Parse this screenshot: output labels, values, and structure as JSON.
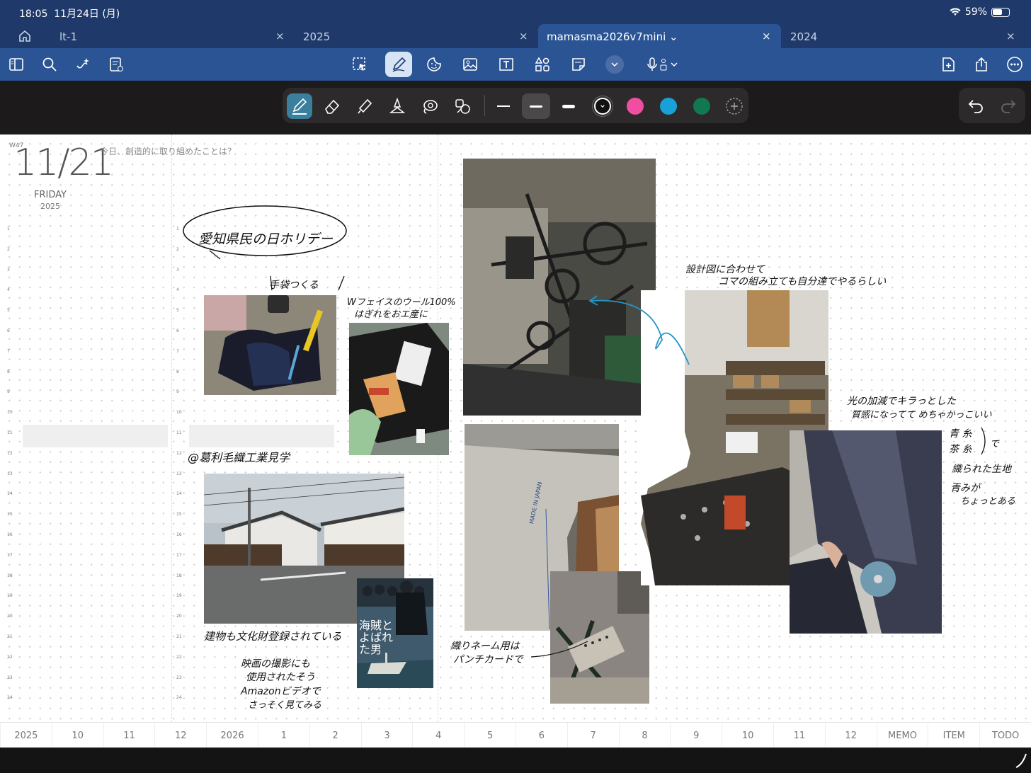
{
  "status": {
    "time": "18:05",
    "date": "11月24日 (月)",
    "battery": "59%"
  },
  "tabs": [
    {
      "label": "lt-1"
    },
    {
      "label": "2025"
    },
    {
      "label": "mamasma2026v7mini ⌄"
    },
    {
      "label": "2024"
    }
  ],
  "toolbar": {
    "left_icons": [
      "sidebar-icon",
      "search-icon",
      "ai-sparkle-icon",
      "document-icon"
    ],
    "center_icons": [
      "lasso-icon",
      "pen-icon",
      "sticker-icon",
      "image-icon",
      "textbox-icon",
      "shapes-icon",
      "note-icon",
      "more-chevron-icon",
      "mic-icon"
    ],
    "right_icons": [
      "add-page-icon",
      "share-icon",
      "more-icon"
    ]
  },
  "pen_tools": {
    "tools": [
      "pen-icon",
      "eraser-icon",
      "highlighter-icon",
      "shape-pen-icon",
      "lasso-pen-icon",
      "element-icon"
    ],
    "colors": [
      "#111111",
      "#f04ea1",
      "#17a1d6",
      "#11784f"
    ]
  },
  "page": {
    "week": "W47",
    "date": "11/21",
    "weekday": "FRIDAY",
    "year": "2025",
    "prompt": "今日、創造的に取り組めたことは？",
    "hours": [
      "1",
      "2",
      "3",
      "4",
      "5",
      "6",
      "7",
      "8",
      "9",
      "10",
      "11",
      "12",
      "13",
      "14",
      "15",
      "16",
      "17",
      "18",
      "19",
      "20",
      "21",
      "22",
      "23",
      "24"
    ]
  },
  "notes": {
    "holiday": "愛知県民の日ホリデー",
    "tebukuro": "手袋つくる",
    "wool_1": "Wフェイスのウール100%",
    "wool_2": "はぎれをおエ産に",
    "kenkaku": "@葛利毛織工業見学",
    "building": "建物も文化財登録されている",
    "movie_1": "映画の撮影にも",
    "movie_2": "使用されたそう",
    "movie_3": "Amazonビデオで",
    "movie_4": "さっそく見てみる",
    "punch_1": "織りネーム用は",
    "punch_2": "パンチカードで",
    "design_1": "設計図に合わせて",
    "design_2": "コマの組み立ても自分達でやるらしい",
    "light_1": "光の加減でキラっとした",
    "light_2": "質感になってて めちゃかっこいい",
    "blue_1": "青 糸",
    "blue_2": "茶 糸",
    "blue_3": "で",
    "blue_4": "織られた生地",
    "blue_5": "青みが",
    "blue_6": "ちょっとある",
    "poster_title": "海賊とよばれた男",
    "fabric_stamp": "MADE IN JAPAN"
  },
  "month_tabs": [
    "2025",
    "10",
    "11",
    "12",
    "2026",
    "1",
    "2",
    "3",
    "4",
    "5",
    "6",
    "7",
    "8",
    "9",
    "10",
    "11",
    "12",
    "MEMO",
    "ITEM",
    "TODO"
  ]
}
